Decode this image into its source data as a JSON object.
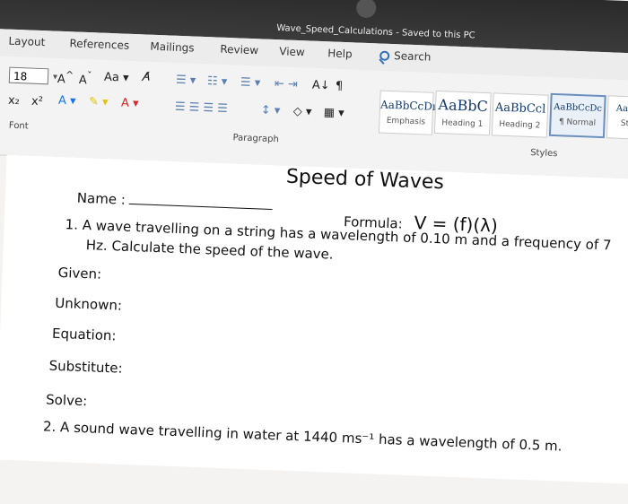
{
  "window": {
    "title": "Wave_Speed_Calculations - Saved to this PC"
  },
  "tabs": [
    {
      "label": "Layout"
    },
    {
      "label": "References"
    },
    {
      "label": "Mailings"
    },
    {
      "label": "Review"
    },
    {
      "label": "View"
    },
    {
      "label": "Help"
    },
    {
      "label": "Search"
    }
  ],
  "ribbon": {
    "font_size": "18",
    "font_group_label": "Font",
    "paragraph_group_label": "Paragraph",
    "styles_group_label": "Styles",
    "styles": [
      {
        "sample": "AaBbCcDı",
        "name": "Emphasis"
      },
      {
        "sample": "AaBbC",
        "name": "Heading 1"
      },
      {
        "sample": "AaBbCcl",
        "name": "Heading 2"
      },
      {
        "sample": "AaBbCcDc",
        "name": "¶ Normal"
      },
      {
        "sample": "AaB",
        "name": "St"
      }
    ]
  },
  "document": {
    "title": "Speed of Waves",
    "name_label": "Name :",
    "formula_label": "Formula:",
    "formula": "V = (f)(λ)",
    "q1_line1": "1.  A wave travelling on a string has a wavelength of 0.10 m and a frequency of 7",
    "q1_line2": "Hz.  Calculate the speed of the wave.",
    "given": "Given:",
    "unknown": "Unknown:",
    "equation": "Equation:",
    "substitute": "Substitute:",
    "solve": "Solve:",
    "q2_line1": "2.  A sound wave travelling in water at 1440 ms⁻¹ has a wavelength of 0.5 m."
  }
}
